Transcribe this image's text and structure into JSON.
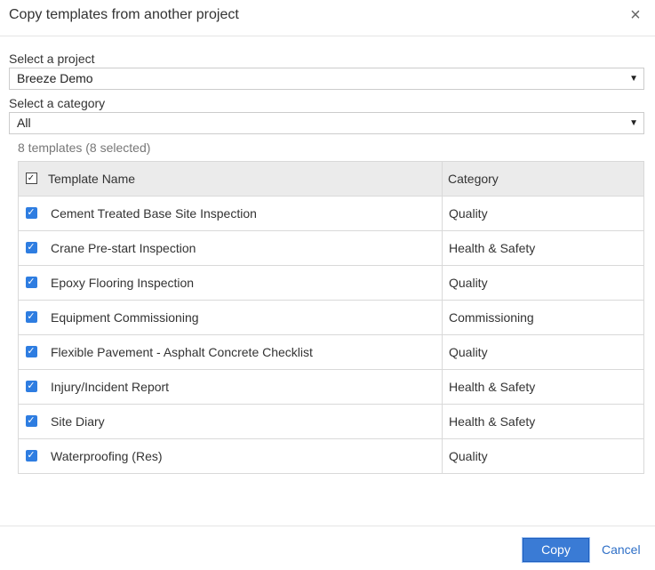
{
  "dialog": {
    "title": "Copy templates from another project",
    "close_glyph": "×"
  },
  "project": {
    "label": "Select a project",
    "selected": "Breeze Demo"
  },
  "category": {
    "label": "Select a category",
    "selected": "All"
  },
  "summary": "8 templates (8 selected)",
  "table": {
    "headers": {
      "name": "Template Name",
      "category": "Category"
    },
    "rows": [
      {
        "name": "Cement Treated Base Site Inspection",
        "category": "Quality",
        "checked": true
      },
      {
        "name": "Crane Pre-start Inspection",
        "category": "Health & Safety",
        "checked": true
      },
      {
        "name": "Epoxy Flooring Inspection",
        "category": "Quality",
        "checked": true
      },
      {
        "name": "Equipment Commissioning",
        "category": "Commissioning",
        "checked": true
      },
      {
        "name": "Flexible Pavement - Asphalt Concrete Checklist",
        "category": "Quality",
        "checked": true
      },
      {
        "name": "Injury/Incident Report",
        "category": "Health & Safety",
        "checked": true
      },
      {
        "name": "Site Diary",
        "category": "Health & Safety",
        "checked": true
      },
      {
        "name": "Waterproofing (Res)",
        "category": "Quality",
        "checked": true
      }
    ]
  },
  "footer": {
    "copy_label": "Copy",
    "cancel_label": "Cancel"
  },
  "colors": {
    "accent": "#3a7bd5",
    "checkbox": "#2e7de1",
    "link": "#2e6fc7"
  }
}
